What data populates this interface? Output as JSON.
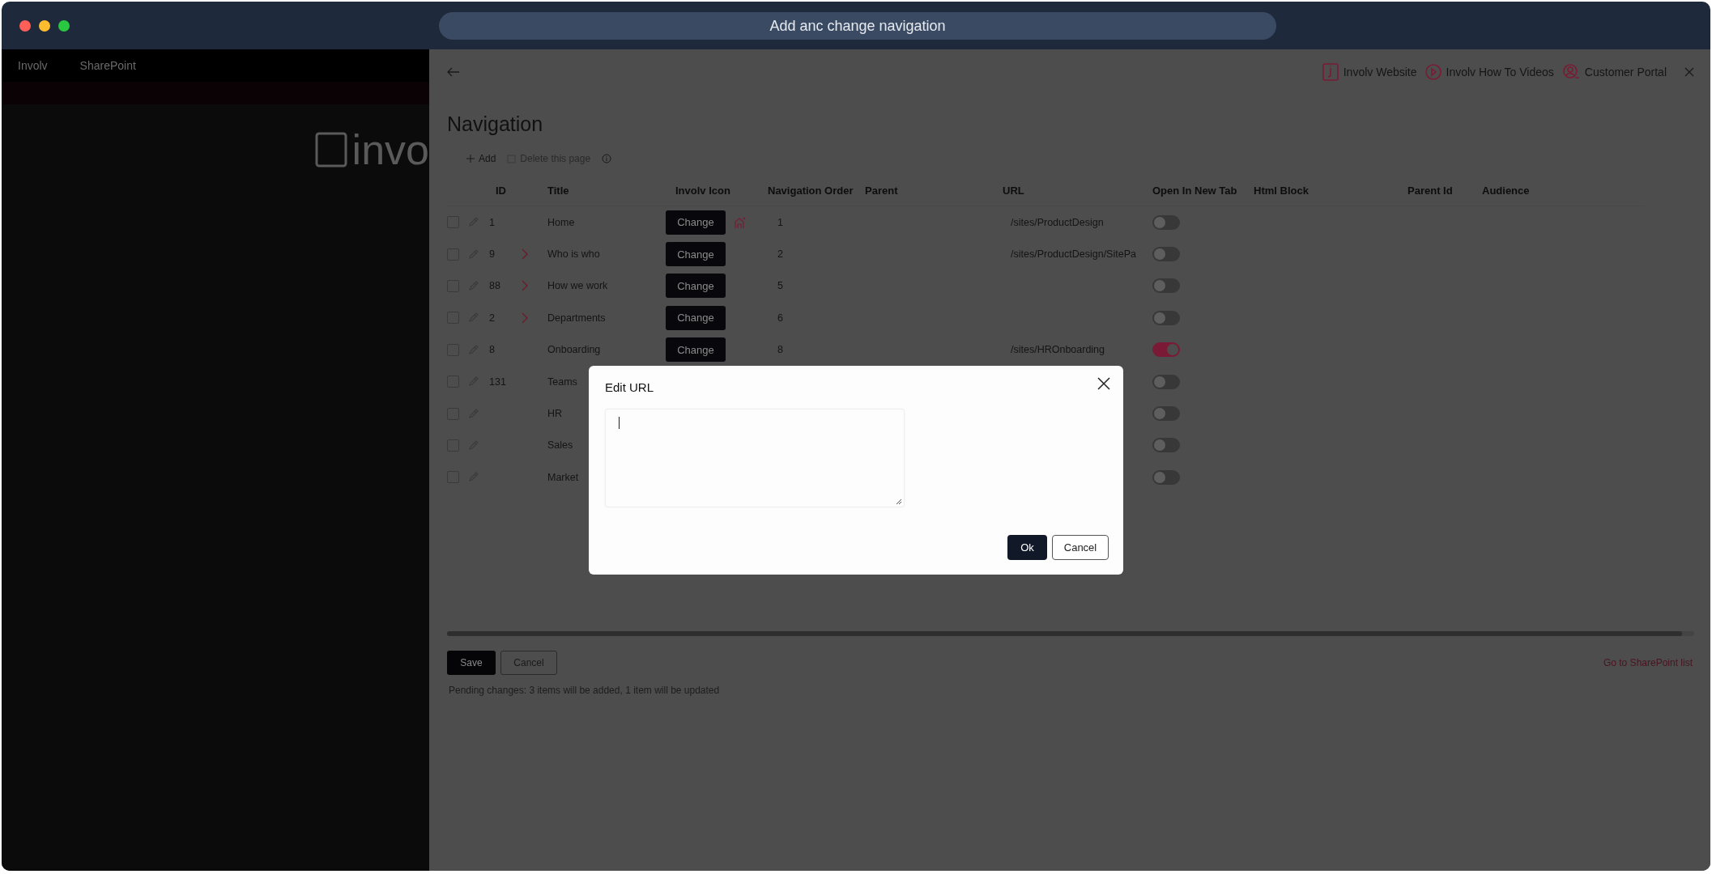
{
  "window": {
    "title": "Add anc change navigation"
  },
  "background_app": {
    "brand": "Involv",
    "product": "SharePoint",
    "logo_text": "invo"
  },
  "panel": {
    "links": [
      {
        "kind": "website",
        "label": "Involv Website"
      },
      {
        "kind": "videos",
        "label": "Involv How To Videos"
      },
      {
        "kind": "portal",
        "label": "Customer Portal"
      }
    ],
    "heading": "Navigation",
    "toolbar": {
      "add": "Add",
      "delete": "Delete this page",
      "delete_disabled": true
    },
    "table": {
      "columns": [
        "ID",
        "Title",
        "Involv Icon",
        "Navigation Order",
        "Parent",
        "URL",
        "Open In New Tab",
        "Html Block",
        "Parent Id",
        "Audience"
      ],
      "rows": [
        {
          "checked": false,
          "id": "1",
          "has_children": false,
          "title": "Home",
          "button": "Change",
          "has_icon": true,
          "order": "1",
          "url": "/sites/ProductDesign",
          "open_in_new_tab": false
        },
        {
          "checked": false,
          "id": "9",
          "has_children": true,
          "title": "Who is who",
          "button": "Change",
          "has_icon": false,
          "order": "2",
          "url": "/sites/ProductDesign/SitePa",
          "open_in_new_tab": false
        },
        {
          "checked": false,
          "id": "88",
          "has_children": true,
          "title": "How we work",
          "button": "Change",
          "has_icon": false,
          "order": "5",
          "open_in_new_tab": false
        },
        {
          "checked": false,
          "id": "2",
          "has_children": true,
          "title": "Departments",
          "button": "Change",
          "has_icon": false,
          "order": "6",
          "open_in_new_tab": false
        },
        {
          "checked": false,
          "id": "8",
          "has_children": false,
          "title": "Onboarding",
          "button": "Change",
          "has_icon": false,
          "order": "8",
          "url": "/sites/HROnboarding",
          "open_in_new_tab": true
        },
        {
          "checked": false,
          "id": "131",
          "has_children": false,
          "title": "Teams",
          "has_icon": false,
          "open_in_new_tab": false
        },
        {
          "checked": false,
          "has_children": false,
          "title": "HR",
          "has_icon": false,
          "open_in_new_tab": false
        },
        {
          "checked": false,
          "has_children": false,
          "title": "Sales",
          "has_icon": false,
          "open_in_new_tab": false
        },
        {
          "checked": false,
          "has_children": false,
          "title": "Market",
          "has_icon": false,
          "open_in_new_tab": false
        }
      ]
    },
    "footer": {
      "save": "Save",
      "cancel": "Cancel",
      "link": "Go to SharePoint list",
      "status": "Pending changes: 3 items will be added, 1 item will be updated"
    }
  },
  "dialog": {
    "title": "Edit URL",
    "ok": "Ok",
    "cancel": "Cancel"
  }
}
